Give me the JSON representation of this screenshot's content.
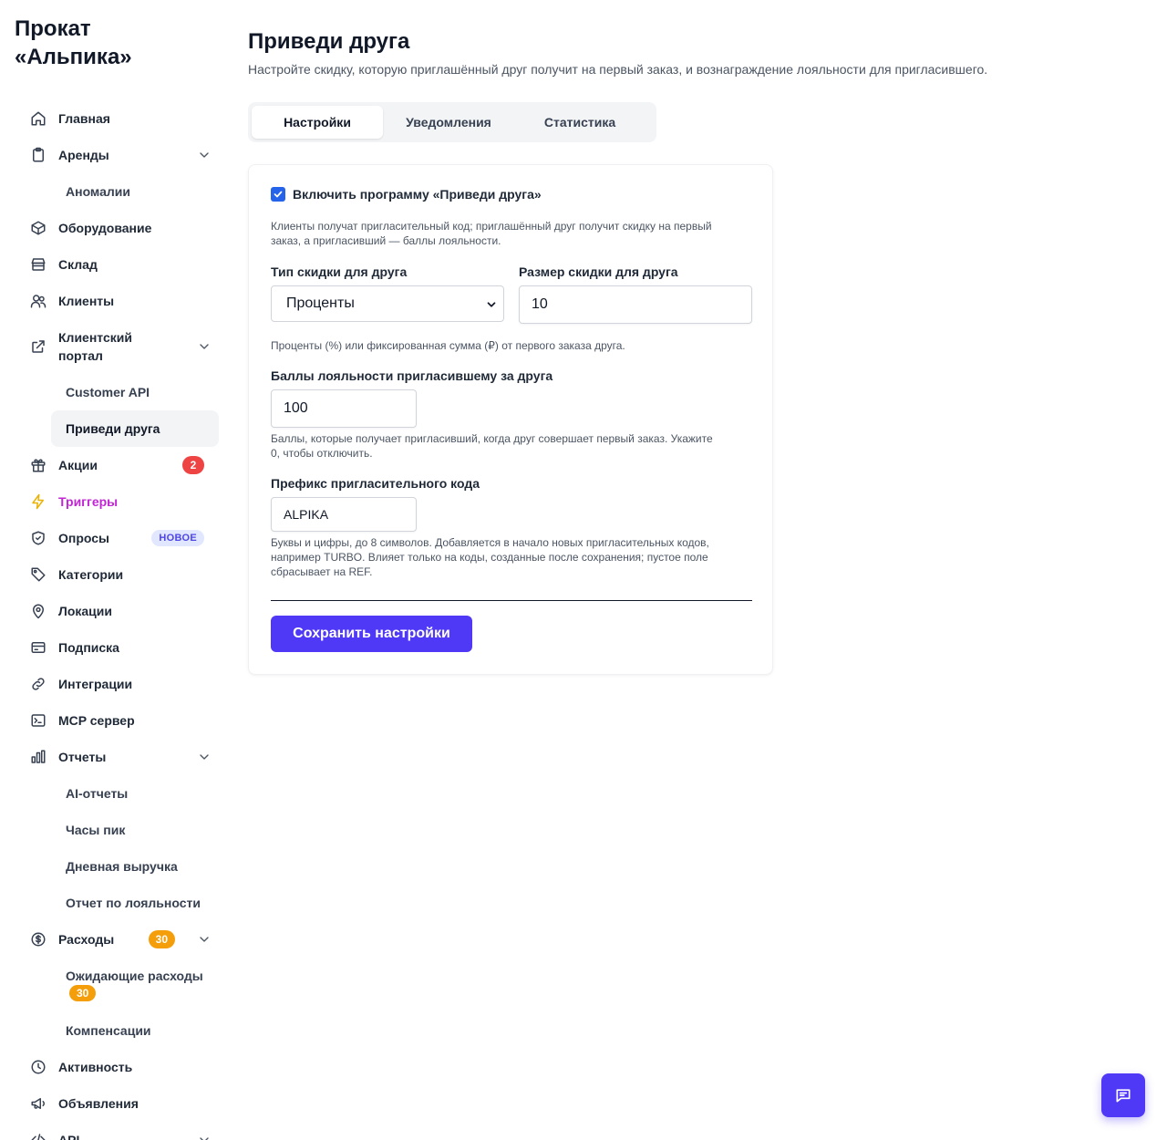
{
  "brand": {
    "line1": "Прокат",
    "line2": "«Альпика»"
  },
  "nav": {
    "home": "Главная",
    "rentals": "Аренды",
    "anomalies": "Аномалии",
    "equipment": "Оборудование",
    "warehouse": "Склад",
    "clients": "Клиенты",
    "client_portal_l1": "Клиентский",
    "client_portal_l2": "портал",
    "customer_api": "Customer API",
    "refer_friend": "Приведи друга",
    "promotions": "Акции",
    "promotions_badge": "2",
    "triggers": "Триггеры",
    "surveys": "Опросы",
    "surveys_badge": "НОВОЕ",
    "categories": "Категории",
    "locations": "Локации",
    "subscription": "Подписка",
    "integrations": "Интеграции",
    "mcp": "MCP сервер",
    "reports": "Отчеты",
    "ai_reports": "AI-отчеты",
    "peak_hours": "Часы пик",
    "daily_revenue": "Дневная выручка",
    "loyalty_report": "Отчет по лояльности",
    "expenses": "Расходы",
    "expenses_badge": "30",
    "pending_expenses": "Ожидающие расходы",
    "pending_badge": "30",
    "compensations": "Компенсации",
    "activity": "Активность",
    "announcements": "Объявления",
    "api": "API"
  },
  "page": {
    "title": "Приведи друга",
    "subtitle": "Настройте скидку, которую приглашённый друг получит на первый заказ, и вознаграждение лояльности для пригласившего."
  },
  "tabs": [
    "Настройки",
    "Уведомления",
    "Статистика"
  ],
  "form": {
    "enable_label": "Включить программу «Приведи друга»",
    "enable_checked": true,
    "enable_help_1": "Клиенты получат пригласительный код; приглашённый друг получит скидку на первый",
    "enable_help_2": "заказ, а пригласивший — баллы лояльности.",
    "discount_type_label": "Тип скидки для друга",
    "discount_type_value": "Проценты",
    "discount_size_label": "Размер скидки для друга",
    "discount_size_value": "10",
    "discount_help": "Проценты (%) или фиксированная сумма (₽) от первого заказа друга.",
    "points_label": "Баллы лояльности пригласившему за друга",
    "points_value": "100",
    "points_help_1": "Баллы, которые получает пригласивший, когда друг совершает первый заказ. Укажите",
    "points_help_2": "0, чтобы отключить.",
    "prefix_label": "Префикс пригласительного кода",
    "prefix_value": "ALPIKA",
    "prefix_help_1": "Буквы и цифры, до 8 символов. Добавляется в начало новых пригласительных кодов,",
    "prefix_help_2": "например TURBO. Влияет только на коды, созданные после сохранения; пустое поле",
    "prefix_help_3": "сбрасывает на REF.",
    "save_label": "Сохранить настройки"
  },
  "colors": {
    "accent": "#4f39f6",
    "checkbox": "#2563eb",
    "badge_red": "#ef4444",
    "badge_orange": "#f59e0b",
    "trigger_text": "#c026d3"
  }
}
